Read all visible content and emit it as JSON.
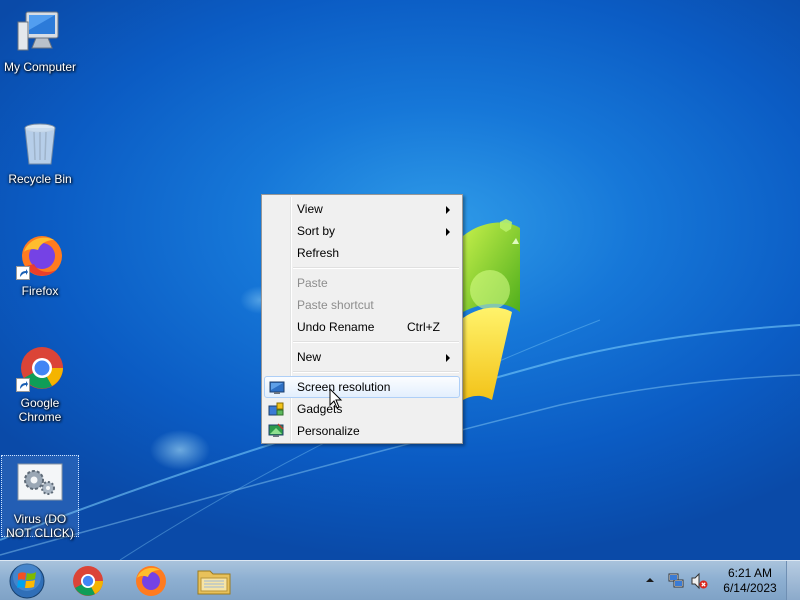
{
  "desktop": {
    "icons": [
      {
        "label": "My Computer",
        "icon": "computer-icon"
      },
      {
        "label": "Recycle Bin",
        "icon": "recycle-bin-icon"
      },
      {
        "label": "Firefox",
        "icon": "firefox-icon"
      },
      {
        "label": "Google Chrome",
        "icon": "chrome-icon"
      },
      {
        "label": "Virus (DO NOT CLICK)",
        "icon": "settings-gear-icon"
      }
    ]
  },
  "context_menu": {
    "items": [
      {
        "label": "View",
        "has_submenu": true
      },
      {
        "label": "Sort by",
        "has_submenu": true
      },
      {
        "label": "Refresh"
      },
      {
        "label": "Paste",
        "disabled": true
      },
      {
        "label": "Paste shortcut",
        "disabled": true
      },
      {
        "label": "Undo Rename",
        "shortcut": "Ctrl+Z"
      },
      {
        "label": "New",
        "has_submenu": true
      },
      {
        "label": "Screen resolution",
        "icon": "display-icon",
        "highlighted": true
      },
      {
        "label": "Gadgets",
        "icon": "gadgets-icon"
      },
      {
        "label": "Personalize",
        "icon": "personalize-icon"
      }
    ]
  },
  "taskbar": {
    "pinned": [
      {
        "name": "Google Chrome",
        "icon": "chrome-icon"
      },
      {
        "name": "Firefox",
        "icon": "firefox-icon"
      },
      {
        "name": "File Explorer",
        "icon": "folder-icon"
      }
    ],
    "clock": {
      "time": "6:21 AM",
      "date": "6/14/2023"
    }
  },
  "colors": {
    "desktop_blue": "#1677d8",
    "menu_bg": "#f0f0f0",
    "menu_highlight_border": "#aecff7",
    "taskbar": "#8eb0d2"
  }
}
